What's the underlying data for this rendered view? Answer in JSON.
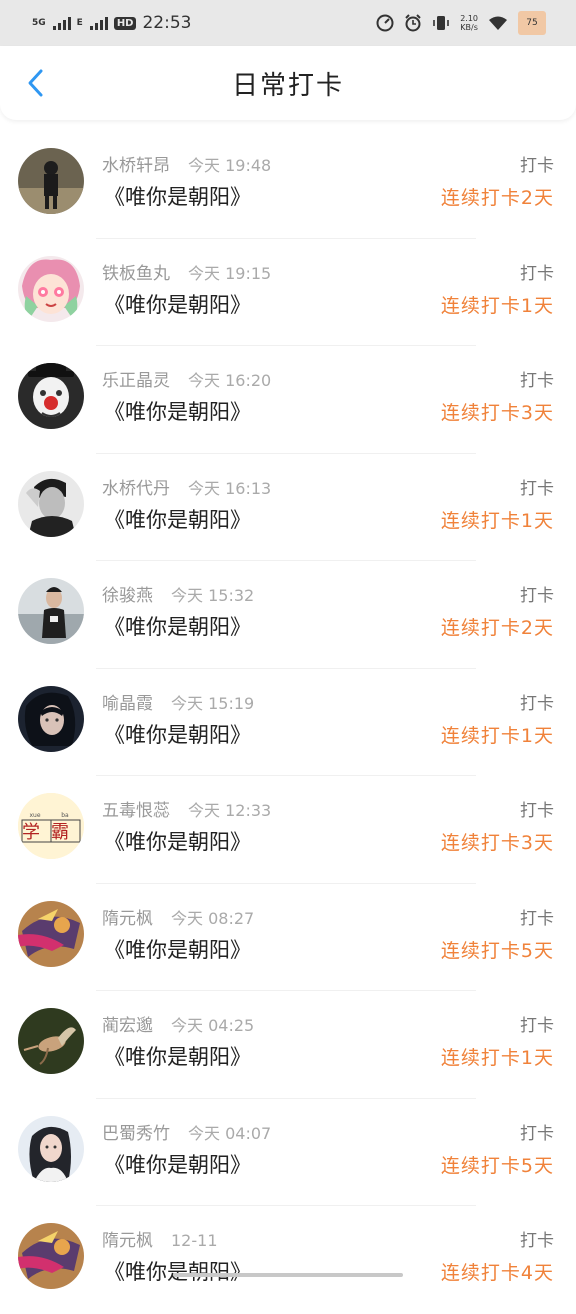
{
  "status": {
    "net1": "5G",
    "net2": "E",
    "time": "22:53",
    "speed_value": "2.10",
    "speed_unit": "KB/s",
    "battery": "75"
  },
  "header": {
    "title": "日常打卡"
  },
  "items": [
    {
      "name": "水桥轩昂",
      "time": "今天 19:48",
      "book": "《唯你是朝阳》",
      "tag": "打卡",
      "streak": "连续打卡2天"
    },
    {
      "name": "铁板鱼丸",
      "time": "今天 19:15",
      "book": "《唯你是朝阳》",
      "tag": "打卡",
      "streak": "连续打卡1天"
    },
    {
      "name": "乐正晶灵",
      "time": "今天 16:20",
      "book": "《唯你是朝阳》",
      "tag": "打卡",
      "streak": "连续打卡3天"
    },
    {
      "name": "水桥代丹",
      "time": "今天 16:13",
      "book": "《唯你是朝阳》",
      "tag": "打卡",
      "streak": "连续打卡1天"
    },
    {
      "name": "徐骏燕",
      "time": "今天 15:32",
      "book": "《唯你是朝阳》",
      "tag": "打卡",
      "streak": "连续打卡2天"
    },
    {
      "name": "喻晶霞",
      "time": "今天 15:19",
      "book": "《唯你是朝阳》",
      "tag": "打卡",
      "streak": "连续打卡1天"
    },
    {
      "name": "五毒恨蕊",
      "time": "今天 12:33",
      "book": "《唯你是朝阳》",
      "tag": "打卡",
      "streak": "连续打卡3天",
      "avatar_text": "学霸",
      "avatar_pinyin": [
        "xue",
        "ba"
      ]
    },
    {
      "name": "隋元枫",
      "time": "今天 08:27",
      "book": "《唯你是朝阳》",
      "tag": "打卡",
      "streak": "连续打卡5天"
    },
    {
      "name": "蔺宏邈",
      "time": "今天 04:25",
      "book": "《唯你是朝阳》",
      "tag": "打卡",
      "streak": "连续打卡1天"
    },
    {
      "name": "巴蜀秀竹",
      "time": "今天 04:07",
      "book": "《唯你是朝阳》",
      "tag": "打卡",
      "streak": "连续打卡5天"
    },
    {
      "name": "隋元枫",
      "time": "12-11",
      "book": "《唯你是朝阳》",
      "tag": "打卡",
      "streak": "连续打卡4天"
    }
  ],
  "colors": {
    "accent": "#f0823a",
    "back_icon": "#2f97f2"
  }
}
